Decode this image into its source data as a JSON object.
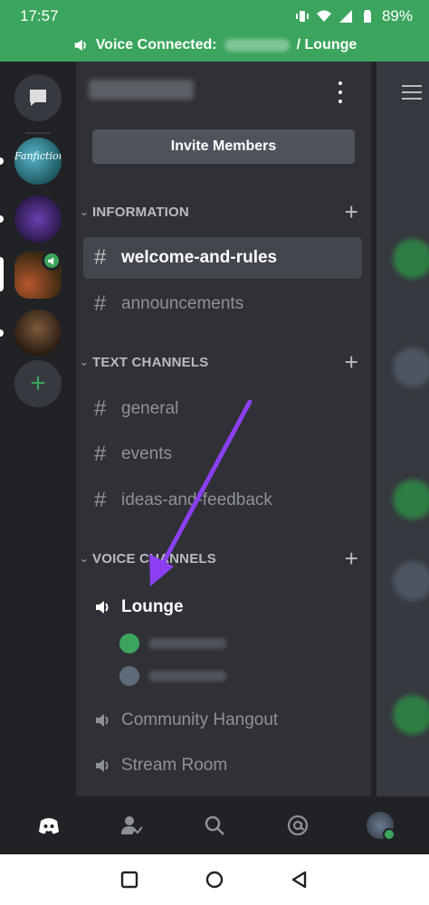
{
  "status_bar": {
    "time": "17:57",
    "battery": "89%"
  },
  "voice_bar": {
    "prefix": "Voice Connected:",
    "channel": "/ Lounge"
  },
  "colors": {
    "voice_green": "#3ba55d",
    "arrow_purple": "#8b3ff0",
    "active_bg": "#42464d"
  },
  "panel": {
    "invite_label": "Invite Members"
  },
  "categories": [
    {
      "name": "INFORMATION",
      "channels": [
        {
          "name": "welcome-and-rules",
          "active": true
        },
        {
          "name": "announcements",
          "active": false
        }
      ]
    },
    {
      "name": "TEXT CHANNELS",
      "channels": [
        {
          "name": "general"
        },
        {
          "name": "events"
        },
        {
          "name": "ideas-and-feedback"
        }
      ]
    },
    {
      "name": "VOICE CHANNELS",
      "channels": [
        {
          "name": "Lounge",
          "connected": true
        },
        {
          "name": "Community Hangout"
        },
        {
          "name": "Stream Room"
        }
      ]
    }
  ],
  "servers": [
    {
      "label": "Fanfiction",
      "icon": "fanfiction-server-icon"
    },
    {
      "icon": "clapper-heart-server-icon"
    },
    {
      "icon": "library-server-icon",
      "voice_active": true
    },
    {
      "icon": "books-server-icon"
    }
  ],
  "icons": {
    "dm": "chat-bubble-icon",
    "add_server": "plus-icon",
    "tabs": [
      "discord-home-icon",
      "friends-icon",
      "search-icon",
      "mentions-icon",
      "profile-avatar"
    ],
    "nav": [
      "recents-icon",
      "home-circle-icon",
      "back-icon"
    ]
  }
}
